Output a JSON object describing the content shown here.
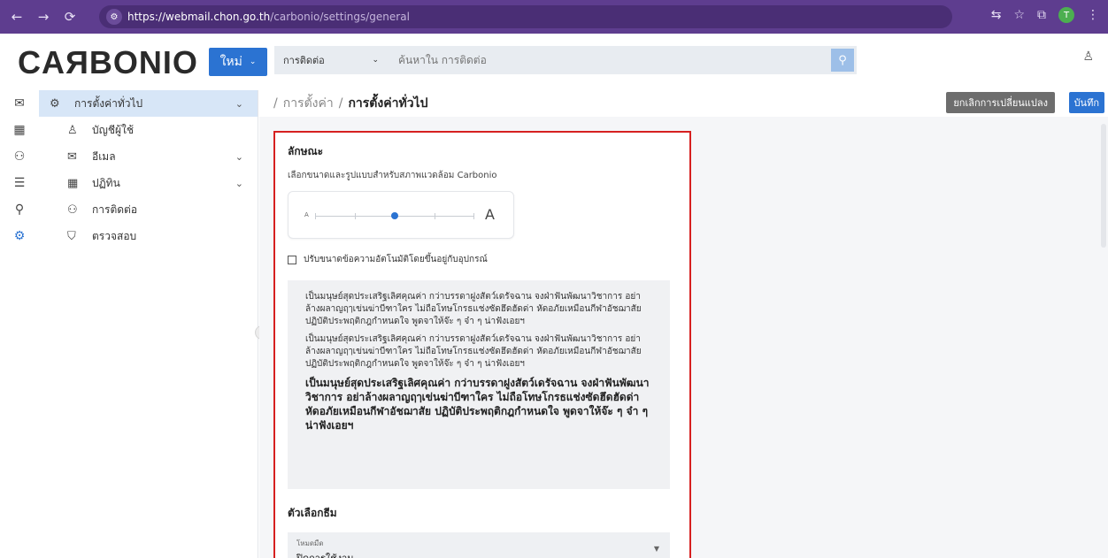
{
  "browser": {
    "url_host": "https://webmail.chon.go.th",
    "url_path": "/carbonio/settings/general",
    "profile_initial": "T"
  },
  "header": {
    "logo": "CAЯBONIO",
    "new_label": "ใหม่",
    "search_scope": "การติดต่อ",
    "search_placeholder": "ค้นหาใน การติดต่อ"
  },
  "sidebar": {
    "items": [
      {
        "label": "การตั้งค่าทั่วไป",
        "icon": "gear-icon"
      },
      {
        "label": "บัญชีผู้ใช้",
        "icon": "user-icon"
      },
      {
        "label": "อีเมล",
        "icon": "mail-icon"
      },
      {
        "label": "ปฏิทิน",
        "icon": "calendar-icon"
      },
      {
        "label": "การติดต่อ",
        "icon": "contacts-icon"
      },
      {
        "label": "ตรวจสอบ",
        "icon": "shield-icon"
      }
    ]
  },
  "breadcrumb": {
    "parent": "การตั้งค่า",
    "current": "การตั้งค่าทั่วไป"
  },
  "actions": {
    "discard_label": "ยกเลิกการเปลี่ยนแปลง",
    "save_label": "บันทึก"
  },
  "appearance": {
    "title": "ลักษณะ",
    "description": "เลือกขนาดและรูปแบบสำหรับสภาพแวดล้อม Carbonio",
    "slider_small": "A",
    "slider_big": "A",
    "slider_level": 0.5,
    "auto_scale_label": "ปรับขนาดข้อความอัตโนมัติโดยขึ้นอยู่กับอุปกรณ์",
    "preview_text_1": "เป็นมนุษย์สุดประเสริฐเลิศคุณค่า กว่าบรรดาฝูงสัตว์เดรัจฉาน จงฝ่าฟันพัฒนาวิชาการ อย่าล้างผลาญฤๅเข่นฆ่าบีฑาใคร ไม่ถือโทษโกรธแช่งซัดฮึดฮัดด่า หัดอภัยเหมือนกีฬาอัชฌาสัย ปฏิบัติประพฤติกฎกำหนดใจ พูดจาให้จ๊ะ ๆ จ๋า ๆ น่าฟังเอยฯ",
    "preview_text_2": "เป็นมนุษย์สุดประเสริฐเลิศคุณค่า กว่าบรรดาฝูงสัตว์เดรัจฉาน จงฝ่าฟันพัฒนาวิชาการ อย่าล้างผลาญฤๅเข่นฆ่าบีฑาใคร ไม่ถือโทษโกรธแช่งซัดฮึดฮัดด่า หัดอภัยเหมือนกีฬาอัชฌาสัย ปฏิบัติประพฤติกฎกำหนดใจ พูดจาให้จ๊ะ ๆ จ๋า ๆ น่าฟังเอยฯ",
    "preview_text_3": "เป็นมนุษย์สุดประเสริฐเลิศคุณค่า กว่าบรรดาฝูงสัตว์เดรัจฉาน จงฝ่าฟันพัฒนาวิชาการ อย่าล้างผลาญฤๅเข่นฆ่าบีฑาใคร ไม่ถือโทษโกรธแช่งซัดฮึดฮัดด่า หัดอภัยเหมือนกีฬาอัชฌาสัย ปฏิบัติประพฤติกฎกำหนดใจ พูดจาให้จ๊ะ ๆ จ๋า ๆ น่าฟังเอยฯ"
  },
  "theme": {
    "title": "ตัวเลือกธีม",
    "dark_mode_label": "โหมดมืด",
    "dark_mode_value": "ปิดการใช้งาน"
  },
  "colors": {
    "browser_bar": "#5e3d8f",
    "accent": "#2b73d2",
    "highlight_border": "#d62020",
    "sidebar_active": "#d7e6f7"
  }
}
